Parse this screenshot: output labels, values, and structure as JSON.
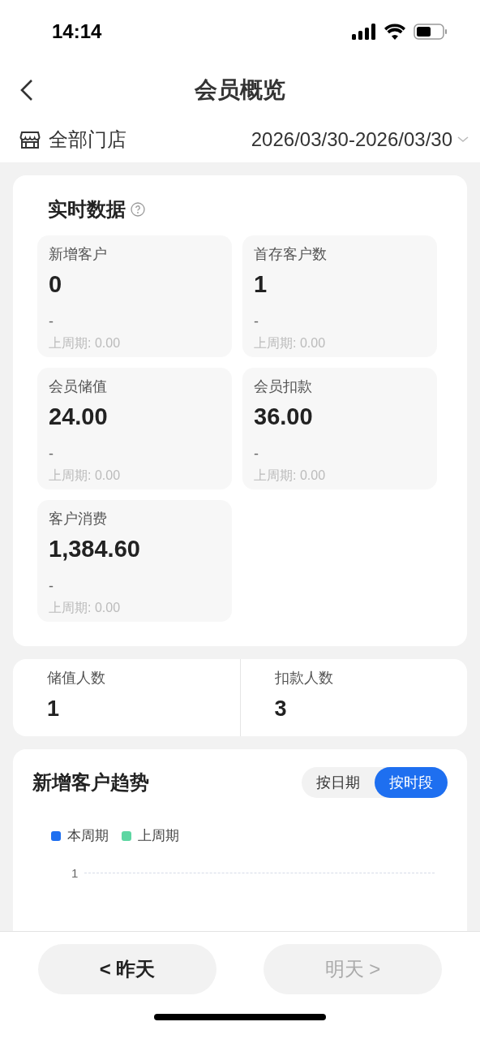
{
  "status_bar": {
    "time": "14:14"
  },
  "nav": {
    "title": "会员概览"
  },
  "filter": {
    "store": "全部门店",
    "date_range": "2026/03/30-2026/03/30"
  },
  "realtime": {
    "title": "实时数据",
    "metrics": [
      {
        "label": "新增客户",
        "value": "0",
        "change": "-",
        "previous": "上周期: 0.00"
      },
      {
        "label": "首存客户数",
        "value": "1",
        "change": "-",
        "previous": "上周期: 0.00"
      },
      {
        "label": "会员储值",
        "value": "24.00",
        "change": "-",
        "previous": "上周期: 0.00"
      },
      {
        "label": "会员扣款",
        "value": "36.00",
        "change": "-",
        "previous": "上周期: 0.00"
      },
      {
        "label": "客户消费",
        "value": "1,384.60",
        "change": "-",
        "previous": "上周期: 0.00"
      }
    ]
  },
  "counts": [
    {
      "label": "储值人数",
      "value": "1"
    },
    {
      "label": "扣款人数",
      "value": "3"
    }
  ],
  "trend": {
    "title": "新增客户趋势",
    "toggle": [
      {
        "label": "按日期",
        "selected": false
      },
      {
        "label": "按时段",
        "selected": true
      }
    ],
    "legend": [
      {
        "label": "本周期",
        "color": "#1e6ff0"
      },
      {
        "label": "上周期",
        "color": "#5dd6a2"
      }
    ],
    "axis_tick": "1"
  },
  "footer": [
    {
      "label": "< 昨天",
      "disabled": false
    },
    {
      "label": "明天 >",
      "disabled": true
    }
  ]
}
